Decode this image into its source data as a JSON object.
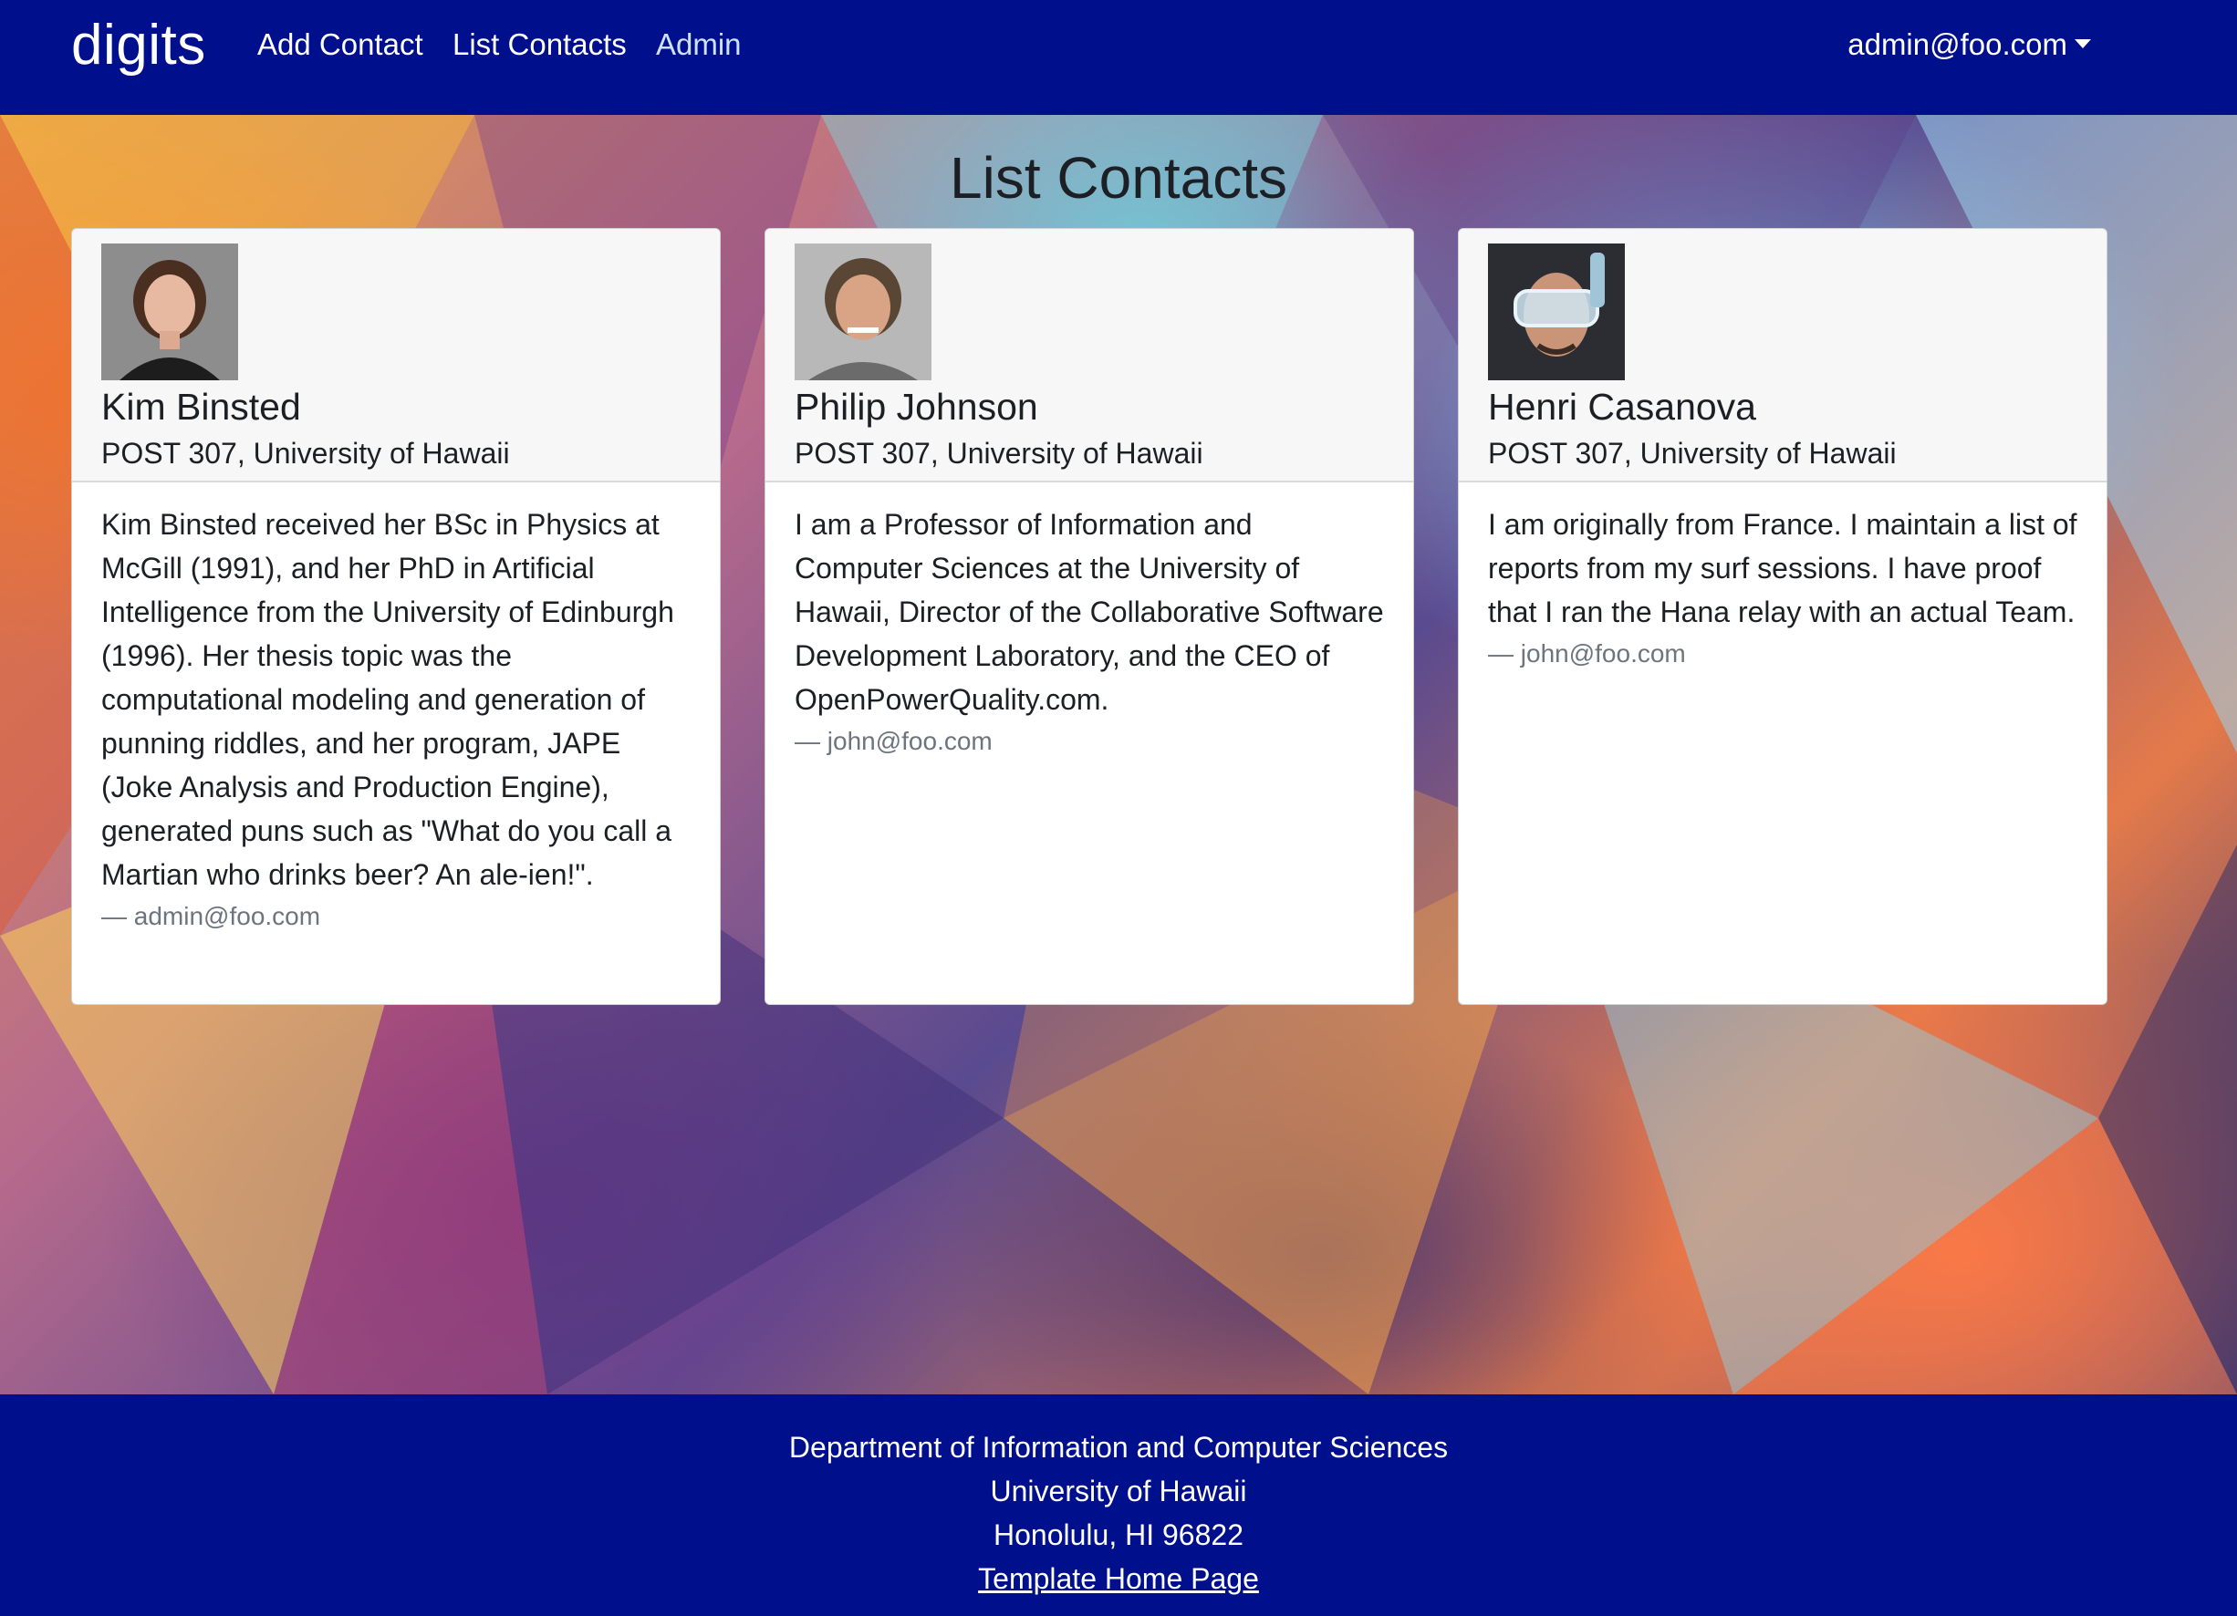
{
  "navbar": {
    "brand": "digits",
    "links": [
      {
        "label": "Add Contact"
      },
      {
        "label": "List Contacts"
      },
      {
        "label": "Admin"
      }
    ],
    "user": "admin@foo.com"
  },
  "page_title": "List Contacts",
  "contacts": [
    {
      "name": "Kim Binsted",
      "address": "POST 307, University of Hawaii",
      "description": "Kim Binsted received her BSc in Physics at McGill (1991), and her PhD in Artificial Intelligence from the University of Edinburgh (1996). Her thesis topic was the computational modeling and generation of punning riddles, and her program, JAPE (Joke Analysis and Production Engine), generated puns such as \"What do you call a Martian who drinks beer? An ale-ien!\".",
      "owner": "— admin@foo.com"
    },
    {
      "name": "Philip Johnson",
      "address": "POST 307, University of Hawaii",
      "description": "I am a Professor of Information and Computer Sciences at the University of Hawaii, Director of the Collaborative Software Development Laboratory, and the CEO of OpenPowerQuality.com.",
      "owner": "— john@foo.com"
    },
    {
      "name": "Henri Casanova",
      "address": "POST 307, University of Hawaii",
      "description": "I am originally from France. I maintain a list of reports from my surf sessions. I have proof that I ran the Hana relay with an actual Team.",
      "owner": "— john@foo.com"
    }
  ],
  "footer": {
    "line1": "Department of Information and Computer Sciences",
    "line2": "University of Hawaii",
    "line3": "Honolulu, HI 96822",
    "link": "Template Home Page"
  },
  "colors": {
    "navbar": "#000f8c",
    "footer": "#000f8c",
    "active_link": "#cfe1ff"
  }
}
